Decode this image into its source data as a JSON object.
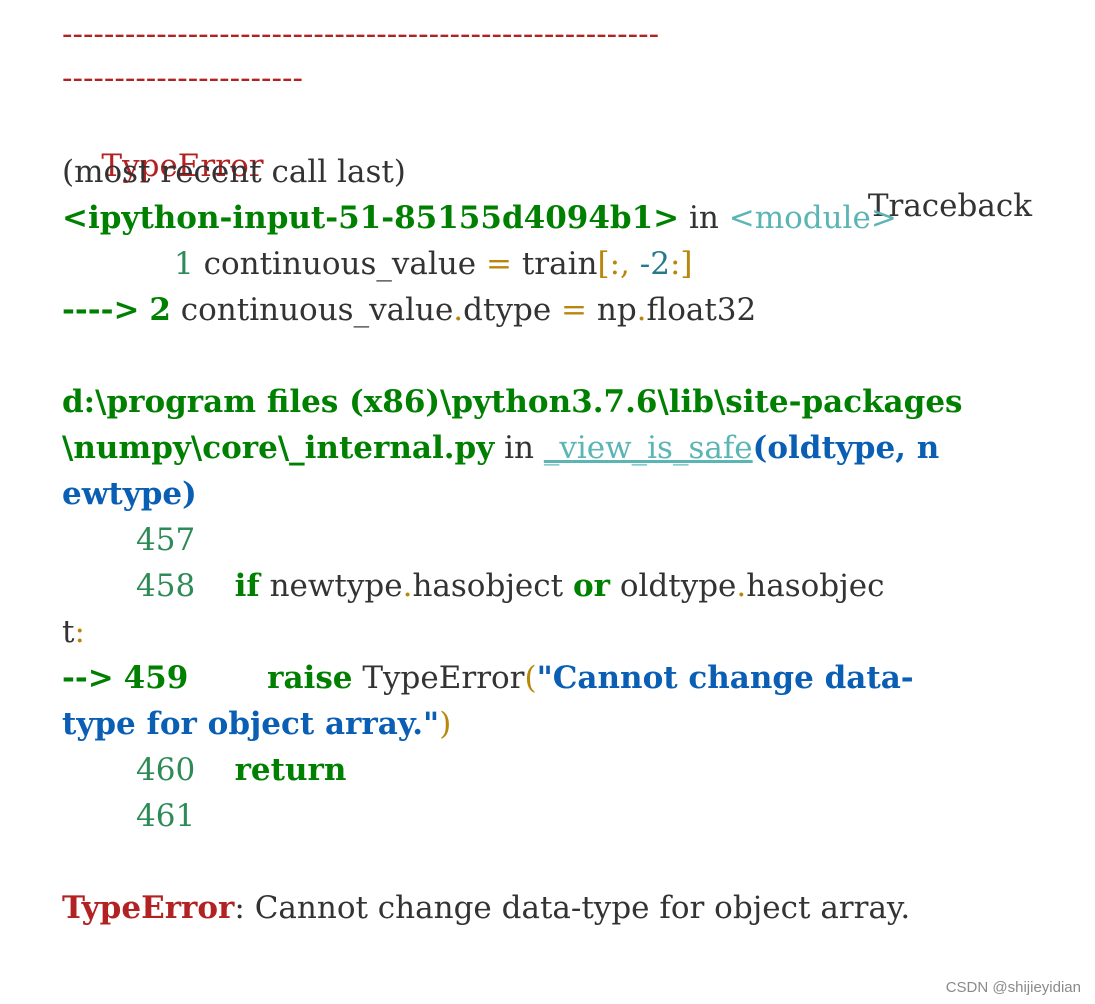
{
  "separator": {
    "line1": "---------------------------------------------------------",
    "line2": "-----------------------"
  },
  "header": {
    "error_name": "TypeError",
    "traceback_label": "Traceback",
    "traceback_label_cont": "(most recent call last)"
  },
  "frame1": {
    "file": "<ipython-input-51-85155d4094b1>",
    "in_word": " in ",
    "func": "<module>",
    "lines": [
      {
        "arrow": "",
        "lineno": "1",
        "code_a": " continuous_value ",
        "code_b": "=",
        "code_c": " train",
        "code_d": "[:,",
        "code_e": " -2",
        "code_f": ":]"
      },
      {
        "arrow": "---->",
        "lineno": "2",
        "code_a": " continuous_value",
        "code_b": ".",
        "code_c": "dtype ",
        "code_d": "=",
        "code_e": " np",
        "code_f": ".",
        "code_g": "float32"
      }
    ]
  },
  "frame2": {
    "file_line1": "d:\\program files (x86)\\python3.7.6\\lib\\site-packages",
    "file_line2": "\\numpy\\core\\_internal.py",
    "in_word": " in ",
    "func": "_view_is_safe",
    "args_part1": "(oldtype, n",
    "args_part2": "ewtype)",
    "lines": [
      {
        "lineno": "457"
      },
      {
        "lineno": "458",
        "kw_if": "if",
        "t1": " newtype",
        "dot1": ".",
        "t2": "hasobject ",
        "kw_or": "or",
        "t3": " oldtype",
        "dot2": ".",
        "t4": "hasobjec",
        "wrap": "t",
        "colon": ":"
      },
      {
        "arrow": "-->",
        "lineno": "459",
        "kw_raise": "raise",
        "t1": " TypeError",
        "paren_open": "(",
        "str1": "\"Cannot change data-",
        "str2": "type for object array.\"",
        "paren_close": ")"
      },
      {
        "lineno": "460",
        "kw_return": "return"
      },
      {
        "lineno": "461"
      }
    ]
  },
  "final_error": {
    "name": "TypeError",
    "message": ": Cannot change data-type for object array."
  },
  "watermark": "CSDN @shijieyidian",
  "colors": {
    "error": "#b22222",
    "green": "#008000",
    "cyan": "#5cb5b5",
    "blue": "#0a5fb4",
    "gold": "#b8860b",
    "text": "#333333"
  }
}
